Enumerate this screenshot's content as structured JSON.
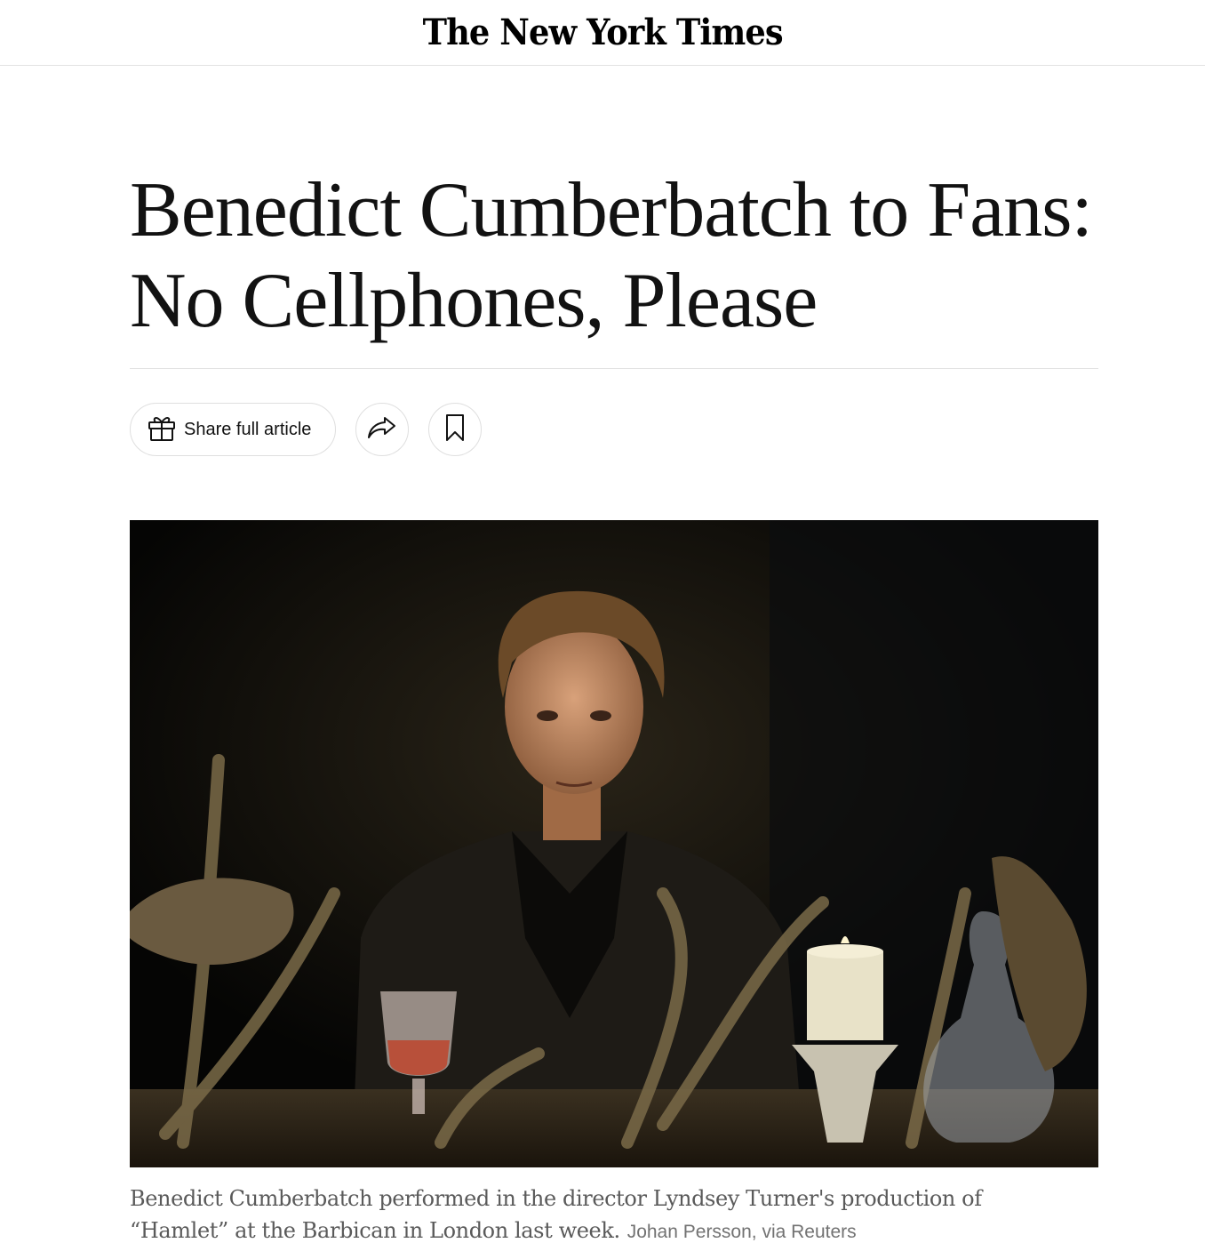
{
  "masthead": {
    "logo_text": "The New York Times"
  },
  "article": {
    "headline": "Benedict Cumberbatch to Fans: No Cellphones, Please"
  },
  "actions": {
    "share_label": "Share full article",
    "share_icon": "gift-icon",
    "forward_icon": "share-arrow-icon",
    "save_icon": "bookmark-icon"
  },
  "image": {
    "caption": "Benedict Cumberbatch performed in the director Lyndsey Turner's production of “Hamlet” at the Barbican in London last week.",
    "credit": "Johan Persson, via Reuters"
  }
}
